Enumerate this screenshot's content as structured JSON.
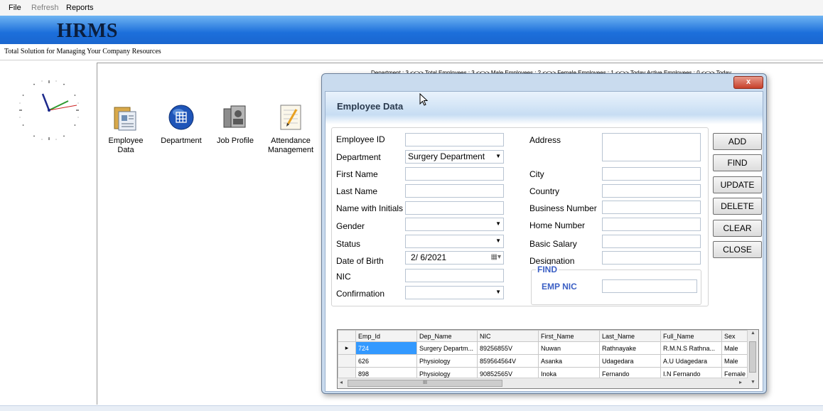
{
  "menu": {
    "file": "File",
    "refresh": "Refresh",
    "reports": "Reports"
  },
  "app": {
    "title": "HRMS",
    "tagline": "Total Solution for Managing Your Company Resources"
  },
  "status_line": "Department : 3 <<>> Total Employees : 3 <<>> Male Employees : 2 <<>> Female Employees : 1 <<>> Today Active Employees : 0 <<>> Today",
  "launchers": [
    {
      "label": "Employee Data",
      "icon": "folder-icon"
    },
    {
      "label": "Department",
      "icon": "grid-globe-icon"
    },
    {
      "label": "Job Profile",
      "icon": "profile-icon"
    },
    {
      "label": "Attendance\nManagement",
      "icon": "notepad-icon"
    }
  ],
  "dialog": {
    "title": "Employee Data",
    "close": "x",
    "labels": {
      "employee_id": "Employee ID",
      "department": "Department",
      "first_name": "First Name",
      "last_name": "Last Name",
      "name_with_initials": "Name with Initials",
      "gender": "Gender",
      "status": "Status",
      "date_of_birth": "Date of Birth",
      "nic": "NIC",
      "confirmation": "Confirmation",
      "address": "Address",
      "city": "City",
      "country": "Country",
      "business_number": "Business Number",
      "home_number": "Home Number",
      "basic_salary": "Basic Salary",
      "designation": "Designation"
    },
    "values": {
      "department": "Surgery Department",
      "date_of_birth": "2/  6/2021"
    },
    "buttons": {
      "add": "ADD",
      "find": "FIND",
      "update": "UPDATE",
      "delete": "DELETE",
      "clear": "CLEAR",
      "close": "CLOSE"
    },
    "find_group": {
      "title": "FIND",
      "label": "EMP NIC"
    }
  },
  "grid": {
    "columns": [
      "Emp_Id",
      "Dep_Name",
      "NIC",
      "First_Name",
      "Last_Name",
      "Full_Name",
      "Sex"
    ],
    "rows": [
      [
        "724",
        "Surgery Departm...",
        "89256855V",
        "Nuwan",
        "Rathnayake",
        "R.M.N.S Rathna...",
        "Male"
      ],
      [
        "626",
        "Physiology",
        "859564564V",
        "Asanka",
        "Udagedara",
        "A.U Udagedara",
        "Male"
      ],
      [
        "898",
        "Physiology",
        "90852565V",
        "Inoka",
        "Fernando",
        "I.N Fernando",
        "Female"
      ]
    ],
    "current_row_marker": "▸",
    "new_row_marker": "*",
    "hscroll_thumb": "III"
  }
}
